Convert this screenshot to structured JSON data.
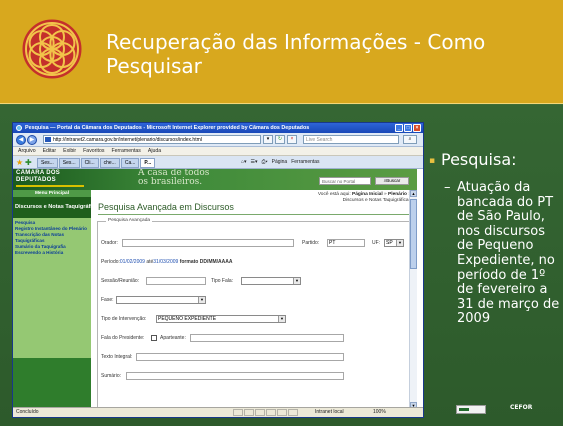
{
  "slide": {
    "title": "Recuperação das Informações - Como Pesquisar",
    "bullet_main": "Pesquisa:",
    "bullet_sub": "Atuação da bancada do PT de São Paulo, nos discursos de Pequeno Expediente, no período de 1º de fevereiro a 31 de março de 2009",
    "footer_logo_right": "CEFOR",
    "colors": {
      "header": "#d8a81e",
      "body": "#356633",
      "bullet_marker": "#e7c040"
    }
  },
  "browser": {
    "window_title": "Pesquisa — Portal da Câmara dos Deputados - Microsoft Internet Explorer provided by Câmara dos Deputados",
    "address": "http://intranet2.camara.gov.br/internet/plenario/discursos/index.html",
    "search_placeholder": "Live Search",
    "menu": [
      "Arquivo",
      "Editar",
      "Exibir",
      "Favoritos",
      "Ferramentas",
      "Ajuda"
    ],
    "tabs": [
      "Ses...",
      "Ses...",
      "Cli...",
      "che...",
      "Ca...",
      "P..."
    ],
    "command_bar": [
      "Página",
      "Ferramentas"
    ],
    "status": {
      "text": "Concluído",
      "zone": "Intranet local",
      "zoom": "100%"
    }
  },
  "site": {
    "logo_line1": "CÂMARA DOS",
    "logo_line2": "DEPUTADOS",
    "slogan_line1": "A casa de todos",
    "slogan_line2": "os brasileiros.",
    "search_placeholder": "Buscar no Portal",
    "search_button": "Buscar",
    "menu_header": "Menu Principal",
    "section_title": "Discursos e Notas Taquigráficas",
    "nav_links": [
      "Pesquisa",
      "Registro Instantâneo do Plenário",
      "Transcrição das Notas Taquigráficas",
      "Sumário da Taquigrafia",
      "Escrevendo a História"
    ],
    "breadcrumb_prefix": "Você está aqui:",
    "breadcrumb_home": "Página Inicial",
    "breadcrumb_sep": "»",
    "breadcrumb_plenario": "Plenário",
    "breadcrumb_section": "Discursos e Notas Taquigráficas",
    "page_heading": "Pesquisa Avançada em Discursos"
  },
  "form": {
    "legend": "Pesquisa Avançada",
    "orador_label": "Orador:",
    "partido_label": "Partido:",
    "partido_value": "PT",
    "uf_label": "UF:",
    "uf_value": "SP",
    "periodo_label": "Período:",
    "periodo_from": "01/02/2009",
    "ate_label": "até",
    "periodo_to": "31/03/2009",
    "date_format": "formato DD/MM/AAAA",
    "sessao_label": "Sessão/Reunião:",
    "tipo_fala_label": "Tipo Fala:",
    "fase_label": "Fase:",
    "tipo_intervencao_label": "Tipo de Intervenção:",
    "tipo_intervencao_value": "PEQUENO EXPEDIENTE",
    "fala_presidente_label": "Fala do Presidente:",
    "aparteante_label": "Aparteante:",
    "texto_integral_label": "Texto Integral:",
    "sumario_label": "Sumário:"
  }
}
